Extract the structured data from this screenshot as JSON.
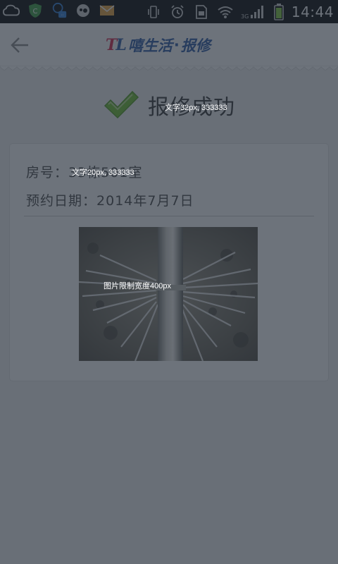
{
  "status_bar": {
    "time": "14:44",
    "network": "3G",
    "left_icons": [
      "cloud-icon",
      "shield-icon",
      "messenger-icon",
      "chat-icon",
      "mail-icon"
    ],
    "right_icons": [
      "vibrate-icon",
      "alarm-icon",
      "sim-icon",
      "wifi-icon",
      "signal-icon",
      "battery-icon"
    ]
  },
  "header": {
    "back_icon": "arrow-left-icon",
    "brand_logo": "TL",
    "brand_name": "嘻生活",
    "brand_dot": "·",
    "brand_sub": "报修",
    "accent_red": "#d6244a",
    "accent_blue": "#2b58a6"
  },
  "success": {
    "icon": "check-icon",
    "text": "报修成功",
    "icon_color": "#6bbf2b"
  },
  "details": {
    "room_label": "房号：",
    "room_value": "33栋501室",
    "date_label": "预约日期：",
    "date_value": "2014年7月7日"
  },
  "annotations": {
    "title_spec": "文字32px, 333333",
    "text_spec": "文字20px, 333333",
    "image_spec": "图片限制宽度400px"
  }
}
